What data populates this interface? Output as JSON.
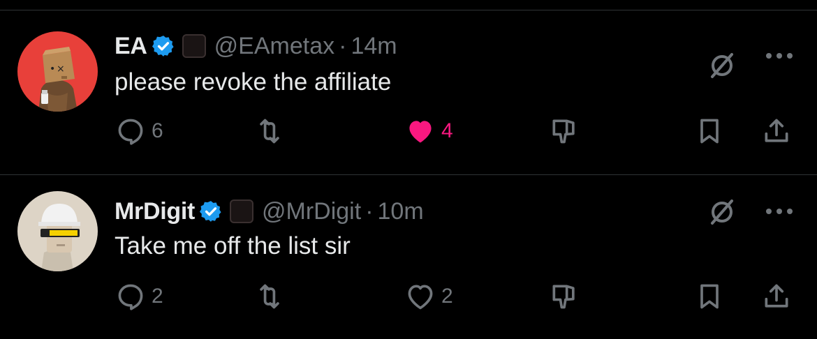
{
  "colors": {
    "background": "#000000",
    "text_primary": "#e7e9ea",
    "text_secondary": "#71767b",
    "verified_blue": "#1d9bf0",
    "like_pink": "#f91880",
    "divider": "#2f3336"
  },
  "tweets": [
    {
      "display_name": "EA",
      "handle": "@EAmetax",
      "separator": "·",
      "time": "14m",
      "text": "please revoke the affiliate",
      "avatar_icon": "box-head-character-avatar",
      "verified": true,
      "replies": "6",
      "likes": "4",
      "liked": true
    },
    {
      "display_name": "MrDigit",
      "handle": "@MrDigit",
      "separator": "·",
      "time": "10m",
      "text": "Take me off the list sir",
      "avatar_icon": "hardhat-visor-character-avatar",
      "verified": true,
      "replies": "2",
      "likes": "2",
      "liked": false
    }
  ]
}
